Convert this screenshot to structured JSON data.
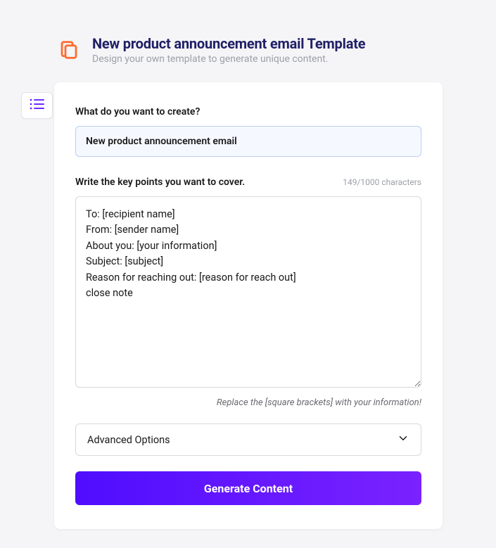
{
  "header": {
    "title": "New product announcement email Template",
    "subtitle": "Design your own template to generate unique content."
  },
  "form": {
    "create_label": "What do you want to create?",
    "create_value": "New product announcement email",
    "keypoints_label": "Write the key points you want to cover.",
    "char_counter": "149/1000 characters",
    "keypoints_value": "To: [recipient name]\nFrom: [sender name]\nAbout you: [your information]\nSubject: [subject]\nReason for reaching out: [reason for reach out]\nclose note",
    "hint": "Replace the [square brackets] with your information!",
    "advanced_label": "Advanced Options",
    "generate_label": "Generate Content"
  }
}
